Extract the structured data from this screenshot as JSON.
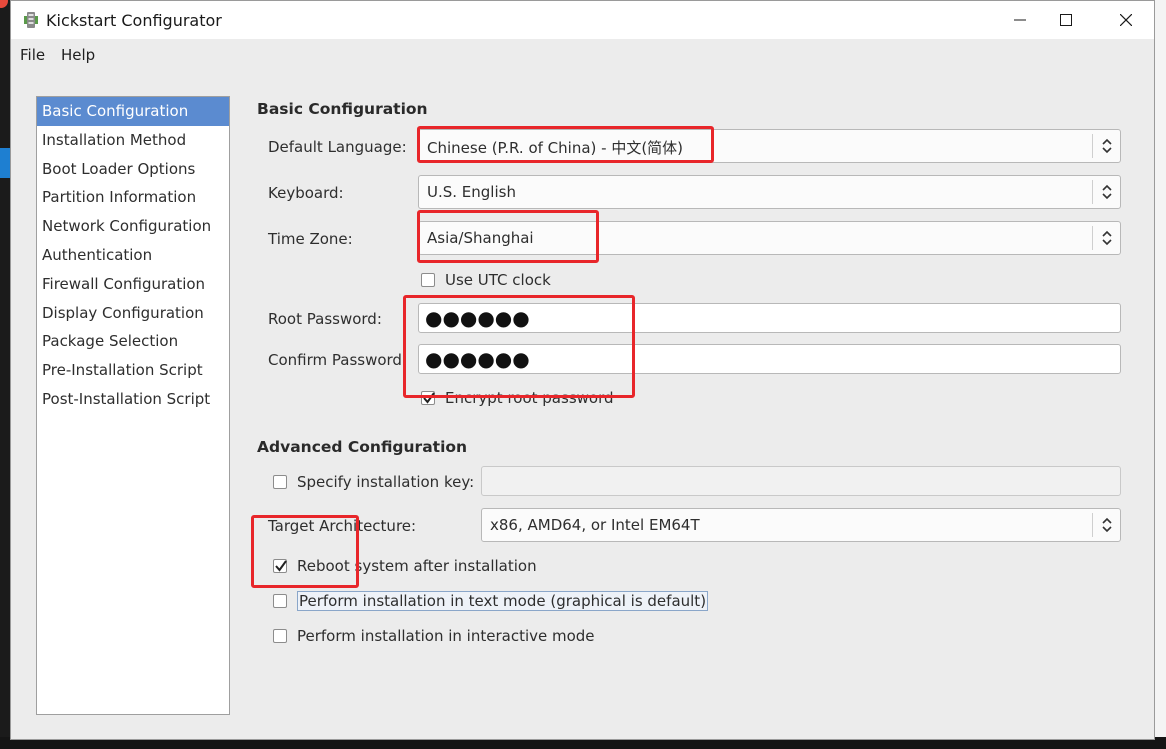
{
  "window": {
    "title": "Kickstart Configurator",
    "controls": [
      "minimize",
      "maximize",
      "close"
    ]
  },
  "menu": {
    "file": "File",
    "help": "Help"
  },
  "sidebar": {
    "items": [
      {
        "label": "Basic Configuration",
        "active": true
      },
      {
        "label": "Installation Method",
        "active": false
      },
      {
        "label": "Boot Loader Options",
        "active": false
      },
      {
        "label": "Partition Information",
        "active": false
      },
      {
        "label": "Network Configuration",
        "active": false
      },
      {
        "label": "Authentication",
        "active": false
      },
      {
        "label": "Firewall Configuration",
        "active": false
      },
      {
        "label": "Display Configuration",
        "active": false
      },
      {
        "label": "Package Selection",
        "active": false
      },
      {
        "label": "Pre-Installation Script",
        "active": false
      },
      {
        "label": "Post-Installation Script",
        "active": false
      }
    ]
  },
  "basic": {
    "section_title": "Basic Configuration",
    "default_language_label": "Default Language:",
    "default_language_value": "Chinese (P.R. of China) - 中文(简体)",
    "keyboard_label": "Keyboard:",
    "keyboard_value": "U.S. English",
    "time_zone_label": "Time Zone:",
    "time_zone_value": "Asia/Shanghai",
    "use_utc_label": "Use UTC clock",
    "use_utc_checked": false,
    "root_password_label": "Root Password:",
    "root_password_mask": "●●●●●●",
    "confirm_password_label": "Confirm Password:",
    "confirm_password_mask": "●●●●●●",
    "encrypt_label": "Encrypt root password",
    "encrypt_checked": true
  },
  "advanced": {
    "section_title": "Advanced Configuration",
    "install_key_label": "Specify installation key:",
    "install_key_checked": false,
    "install_key_value": "",
    "target_arch_label": "Target Architecture:",
    "target_arch_value": "x86, AMD64, or Intel EM64T",
    "reboot_label": "Reboot system after installation",
    "reboot_checked": true,
    "text_mode_label": "Perform installation in text mode (graphical is default)",
    "text_mode_checked": false,
    "interactive_label": "Perform installation in interactive mode",
    "interactive_checked": false
  },
  "colors": {
    "accent": "#5b8bd0",
    "annotation": "#e8262a",
    "window_bg": "#ececec"
  }
}
